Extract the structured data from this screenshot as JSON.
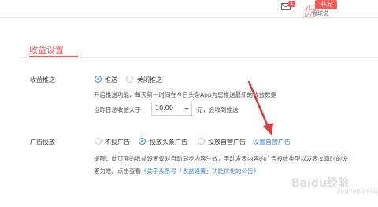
{
  "header": {
    "mail_badge": "1",
    "avatar_char": "侃",
    "avatar_tag": "书友",
    "username": "侃球说"
  },
  "section": {
    "title": "收益设置"
  },
  "income_push": {
    "label": "收益推送",
    "options": [
      "推送",
      "关闭推送"
    ],
    "selected": "推送",
    "description": "开启推送功能，每天第一时间在今日头条App为您推送最新的收益数据",
    "threshold_prefix": "当昨日总收益大于",
    "threshold_value": "10.00",
    "threshold_suffix": "元，会收到推送"
  },
  "ad_delivery": {
    "label": "广告投放",
    "options": [
      "不投广告",
      "投放头条广告",
      "投放自营广告"
    ],
    "selected": "投放头条广告",
    "settings_link": "设置自营广告",
    "notice_line1": "提醒：此页面的收益设置仅对自动同步内容生效，手动发表内容的广告投放类型以发表文章时的设",
    "notice_line2_prefix": "置为准。点击查看",
    "notice_link": "《关于头条号「收益设置」功能优化的公告》"
  },
  "colors": {
    "accent": "#f06060",
    "link": "#3a86e6",
    "annotation_arrow": "#e23a3a"
  },
  "watermark": {
    "main": "Baidu经验",
    "sub": "jingyan.baidu.com"
  }
}
